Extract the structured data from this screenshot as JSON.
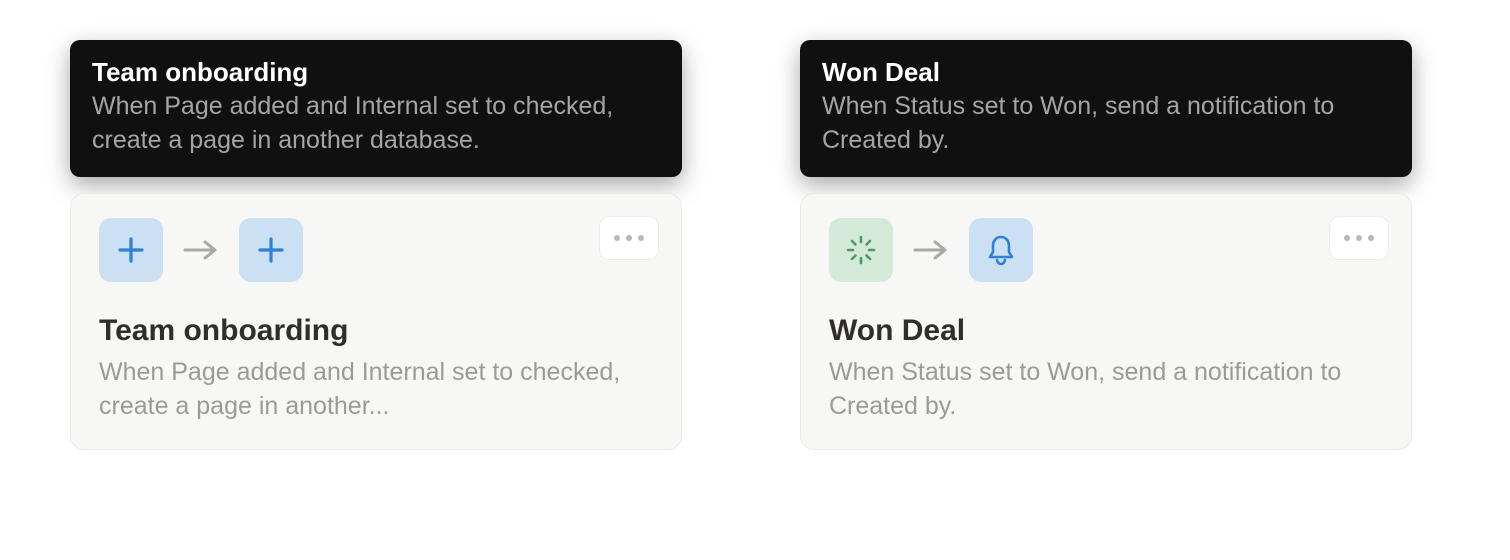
{
  "automations": [
    {
      "tooltip": {
        "title": "Team onboarding",
        "description": "When Page added and Internal set to checked, create a page in another database."
      },
      "card": {
        "title": "Team onboarding",
        "description": "When Page added and Internal set to checked, create a page in another...",
        "trigger_icon": "plus",
        "action_icon": "plus"
      }
    },
    {
      "tooltip": {
        "title": "Won Deal",
        "description": "When Status set to Won, send a notification to Created by."
      },
      "card": {
        "title": "Won Deal",
        "description": "When Status set to Won, send a notification to Created by.",
        "trigger_icon": "spinner",
        "action_icon": "bell"
      }
    }
  ],
  "colors": {
    "tooltip_bg": "#101010",
    "tooltip_desc": "#A6A5A3",
    "card_bg": "#F7F7F5",
    "card_border": "#E9E9E7",
    "icon_blue_bg": "#CBE1F3",
    "icon_green_bg": "#D3EAD9",
    "icon_blue_fg": "#2F80D7",
    "icon_green_fg": "#4F9768",
    "arrow": "#A9A8A6",
    "overflow_dot": "#B8B7B4"
  }
}
